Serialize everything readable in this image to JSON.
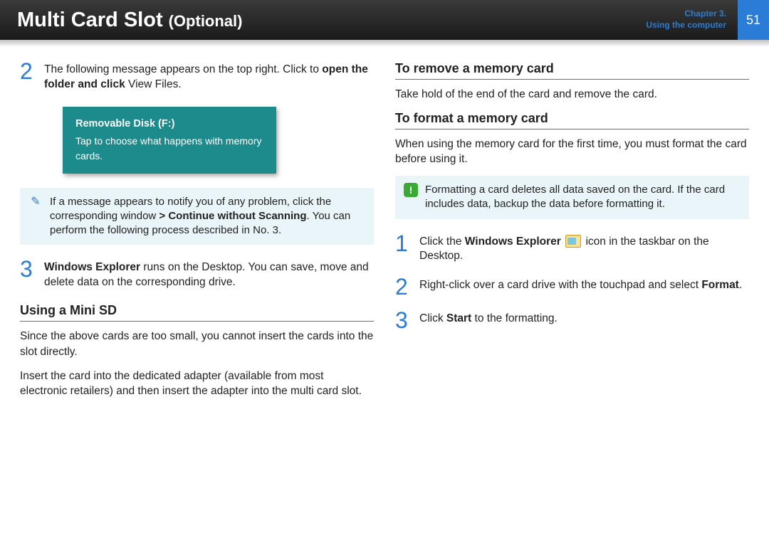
{
  "header": {
    "title_main": "Multi Card Slot",
    "title_suffix": "(Optional)",
    "chapter_label": "Chapter 3.",
    "chapter_sub": "Using the computer",
    "page_number": "51"
  },
  "left": {
    "step2_num": "2",
    "step2_text_a": "The following message appears on the top right. Click to ",
    "step2_text_b": "open the folder and click",
    "step2_text_c": " View Files.",
    "notification_title": "Removable Disk (F:)",
    "notification_body": "Tap to choose what happens with memory cards.",
    "note_text_a": "If a message appears to notify you of any problem, click the corresponding window ",
    "note_text_b": "> Continue without Scanning",
    "note_text_c": ". You can perform the following process described in No. 3.",
    "step3_num": "3",
    "step3_text_a": "Windows Explorer",
    "step3_text_b": " runs on the Desktop. You can save, move and delete data on the corresponding drive.",
    "heading_minisd": "Using a Mini SD",
    "minisd_p1": "Since the above cards are too small, you cannot insert the cards into the slot directly.",
    "minisd_p2": "Insert the card into the dedicated adapter (available from most electronic retailers) and then insert the adapter into the multi card slot."
  },
  "right": {
    "heading_remove": "To remove a memory card",
    "remove_p": "Take hold of the end of the card and remove the card.",
    "heading_format": "To format a memory card",
    "format_p": "When using the memory card for the first time, you must format the card before using it.",
    "warn_text": "Formatting a card deletes all data saved on the card. If the card includes data, backup the data before formatting it.",
    "fstep1_num": "1",
    "fstep1_a": "Click the ",
    "fstep1_b": "Windows Explorer",
    "fstep1_c": " icon in the taskbar on the Desktop.",
    "fstep2_num": "2",
    "fstep2_a": "Right-click over a card drive with the touchpad and select ",
    "fstep2_b": "Format",
    "fstep2_c": ".",
    "fstep3_num": "3",
    "fstep3_a": "Click ",
    "fstep3_b": "Start",
    "fstep3_c": " to the formatting."
  }
}
